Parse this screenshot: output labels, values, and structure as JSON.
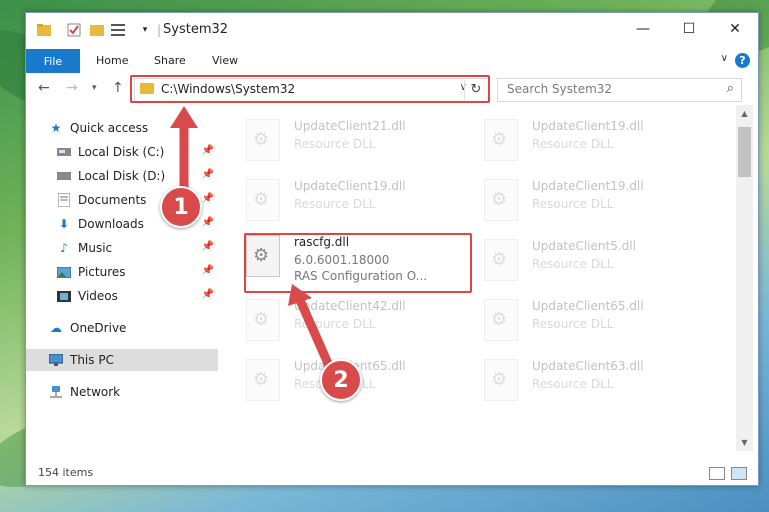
{
  "window": {
    "title": "System32",
    "ribbon_tabs": [
      "File",
      "Home",
      "Share",
      "View"
    ],
    "help": "?"
  },
  "navbar": {
    "address": "C:\\Windows\\System32",
    "search_placeholder": "Search System32"
  },
  "nav": {
    "items": [
      {
        "label": "Quick access",
        "icon": "star-icon"
      },
      {
        "label": "Local Disk (C:)",
        "icon": "drive-icon"
      },
      {
        "label": "Local Disk (D:)",
        "icon": "drive-icon"
      },
      {
        "label": "Documents",
        "icon": "documents-icon"
      },
      {
        "label": "Downloads",
        "icon": "download-icon"
      },
      {
        "label": "Music",
        "icon": "music-icon"
      },
      {
        "label": "Pictures",
        "icon": "pictures-icon"
      },
      {
        "label": "Videos",
        "icon": "videos-icon"
      },
      {
        "label": "OneDrive",
        "icon": "cloud-icon"
      },
      {
        "label": "This PC",
        "icon": "computer-icon"
      },
      {
        "label": "Network",
        "icon": "network-icon"
      }
    ]
  },
  "files": [
    {
      "name": "UpdateClient21.dll",
      "line2": "Resource DLL",
      "line3": ""
    },
    {
      "name": "UpdateClient19.dll",
      "line2": "Resource DLL",
      "line3": ""
    },
    {
      "name": "UpdateClient19.dll",
      "line2": "Resource DLL",
      "line3": ""
    },
    {
      "name": "UpdateClient19.dll",
      "line2": "Resource DLL",
      "line3": ""
    },
    {
      "name": "rascfg.dll",
      "line2": "6.0.6001.18000",
      "line3": "RAS Configuration O..."
    },
    {
      "name": "UpdateClient5.dll",
      "line2": "Resource DLL",
      "line3": ""
    },
    {
      "name": "UpdateClient42.dll",
      "line2": "Resource DLL",
      "line3": ""
    },
    {
      "name": "UpdateClient65.dll",
      "line2": "Resource DLL",
      "line3": ""
    },
    {
      "name": "UpdateClient65.dll",
      "line2": "Resource DLL",
      "line3": ""
    },
    {
      "name": "UpdateClient63.dll",
      "line2": "Resource DLL",
      "line3": ""
    }
  ],
  "status": {
    "items": "154 items"
  },
  "annotations": {
    "step1": "1",
    "step2": "2"
  },
  "colors": {
    "accent": "#1979ca",
    "highlight": "#d44444"
  }
}
